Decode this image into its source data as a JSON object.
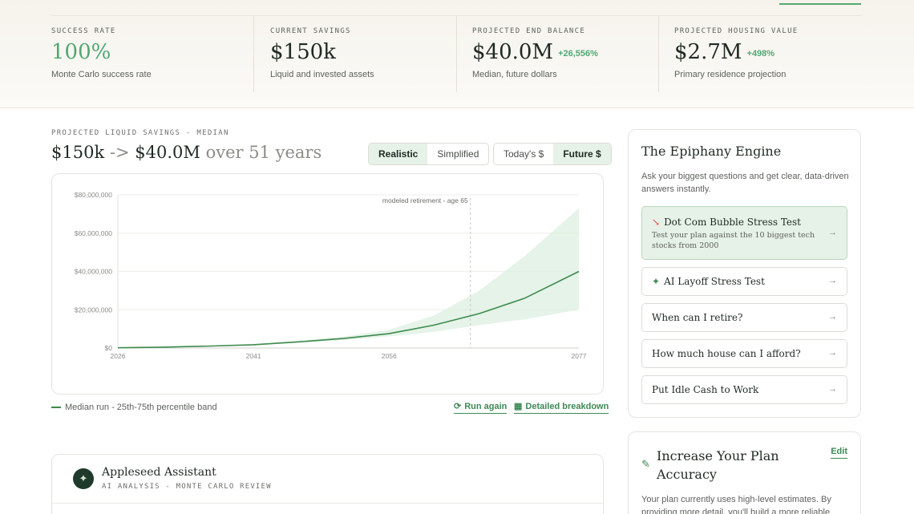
{
  "stats": [
    {
      "label": "SUCCESS RATE",
      "value": "100%",
      "delta": "",
      "sub": "Monte Carlo success rate"
    },
    {
      "label": "CURRENT SAVINGS",
      "value": "$150k",
      "delta": "",
      "sub": "Liquid and invested assets"
    },
    {
      "label": "PROJECTED END BALANCE",
      "value": "$40.0M",
      "delta": "+26,556%",
      "sub": "Median, future dollars"
    },
    {
      "label": "PROJECTED HOUSING VALUE",
      "value": "$2.7M",
      "delta": "+498%",
      "sub": "Primary residence projection"
    }
  ],
  "colors": {
    "accent": "#4fa873",
    "line": "#3f8a4e",
    "band": "#dcefe0",
    "dark": "#1f3a2a"
  },
  "projection": {
    "label": "PROJECTED LIQUID SAVINGS - MEDIAN",
    "from": "$150k",
    "arrow": "->",
    "to": "$40.0M",
    "span": "over 51 years"
  },
  "toggles": {
    "mode": {
      "realistic": "Realistic",
      "simplified": "Simplified",
      "selected": "Realistic"
    },
    "dollars": {
      "today": "Today's $",
      "future": "Future $",
      "selected": "Future $"
    }
  },
  "chart_data": {
    "type": "area",
    "x": [
      2026,
      2031,
      2036,
      2041,
      2046,
      2051,
      2056,
      2061,
      2066,
      2071,
      2077
    ],
    "series": [
      {
        "name": "Median run",
        "values": [
          150000,
          450000,
          1000000,
          1700000,
          3200000,
          5000000,
          7500000,
          12000000,
          18000000,
          26000000,
          40000000
        ]
      },
      {
        "name": "25th-75th percentile band",
        "low": [
          150000,
          400000,
          900000,
          1500000,
          2700000,
          4200000,
          6000000,
          8500000,
          12000000,
          15000000,
          20000000
        ],
        "high": [
          150000,
          500000,
          1200000,
          2000000,
          3800000,
          6000000,
          9500000,
          17000000,
          30000000,
          48000000,
          73000000
        ]
      }
    ],
    "xticks": [
      "2026",
      "2041",
      "2056",
      "2077"
    ],
    "yticks": [
      "$0",
      "$20,000,000",
      "$40,000,000",
      "$60,000,000",
      "$80,000,000"
    ],
    "ylim": [
      0,
      80000000
    ],
    "annotation": {
      "x": 2065,
      "text": "modeled retirement - age 65"
    },
    "grid": true
  },
  "legend": {
    "text": "Median run - 25th-75th percentile band"
  },
  "actions": {
    "run_again": "Run again",
    "breakdown": "Detailed breakdown"
  },
  "assistant": {
    "title": "Appleseed Assistant",
    "subtitle": "AI ANALYSIS - MONTE CARLO REVIEW"
  },
  "engine": {
    "title": "The Epiphany Engine",
    "description": "Ask your biggest questions and get clear, data-driven answers instantly.",
    "questions": [
      {
        "label": "Dot Com Bubble Stress Test",
        "desc": "Test your plan against the 10 biggest tech stocks from 2000",
        "icon": "trending-down-icon"
      },
      {
        "label": "AI Layoff Stress Test",
        "desc": "",
        "icon": "sparkle-icon"
      },
      {
        "label": "When can I retire?",
        "desc": "",
        "icon": ""
      },
      {
        "label": "How much house can I afford?",
        "desc": "",
        "icon": ""
      },
      {
        "label": "Put Idle Cash to Work",
        "desc": "",
        "icon": ""
      }
    ]
  },
  "accuracy": {
    "title": "Increase Your Plan Accuracy",
    "edit": "Edit",
    "description": "Your plan currently uses high-level estimates. By providing more detail, you'll build a more reliable"
  }
}
